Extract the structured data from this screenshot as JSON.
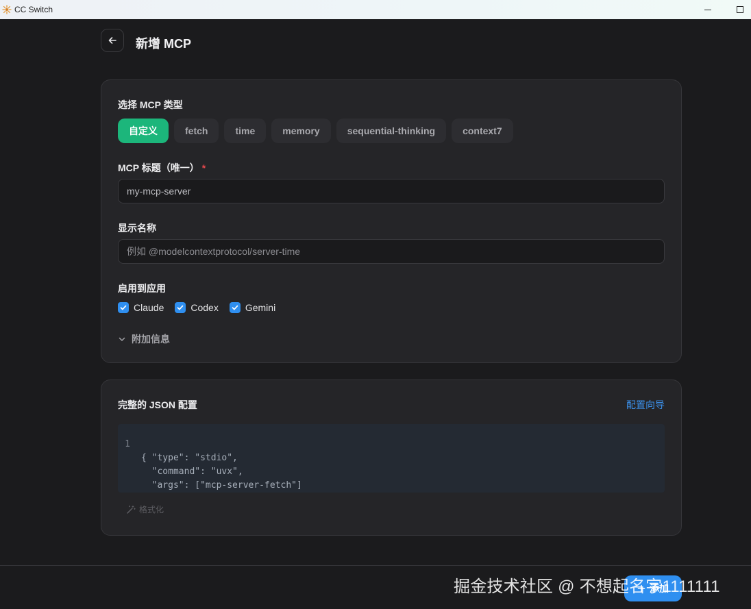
{
  "window": {
    "title": "CC Switch"
  },
  "header": {
    "title": "新增 MCP"
  },
  "mcp_type": {
    "label": "选择 MCP 类型",
    "options": [
      "自定义",
      "fetch",
      "time",
      "memory",
      "sequential-thinking",
      "context7"
    ],
    "selected": "自定义"
  },
  "mcp_title": {
    "label": "MCP 标题（唯一）",
    "required_mark": "*",
    "value": "my-mcp-server"
  },
  "display_name": {
    "label": "显示名称",
    "placeholder": "例如 @modelcontextprotocol/server-time"
  },
  "apps": {
    "label": "启用到应用",
    "items": [
      {
        "label": "Claude",
        "checked": true
      },
      {
        "label": "Codex",
        "checked": true
      },
      {
        "label": "Gemini",
        "checked": true
      }
    ]
  },
  "extra_info": {
    "label": "附加信息"
  },
  "json_config": {
    "title": "完整的 JSON 配置",
    "wizard_link": "配置向导",
    "line_number": "1",
    "lines": [
      "{",
      "  \"type\": \"stdio\",",
      "  \"command\": \"uvx\",",
      "  \"args\": [\"mcp-server-fetch\"]",
      "}"
    ],
    "format_label": "格式化"
  },
  "footer": {
    "add_label": "添加"
  },
  "watermark": {
    "text": "掘金技术社区 @ 不想起名字1111111"
  },
  "colors": {
    "accent_green": "#1cb67b",
    "accent_blue": "#2f8ff0",
    "link_blue": "#3b8fe8",
    "required_red": "#e5484d"
  },
  "icons": [
    "app-logo-icon",
    "minimize-icon",
    "maximize-icon",
    "back-arrow-icon",
    "check-icon",
    "chevron-down-icon",
    "magic-wand-icon",
    "plus-icon"
  ]
}
